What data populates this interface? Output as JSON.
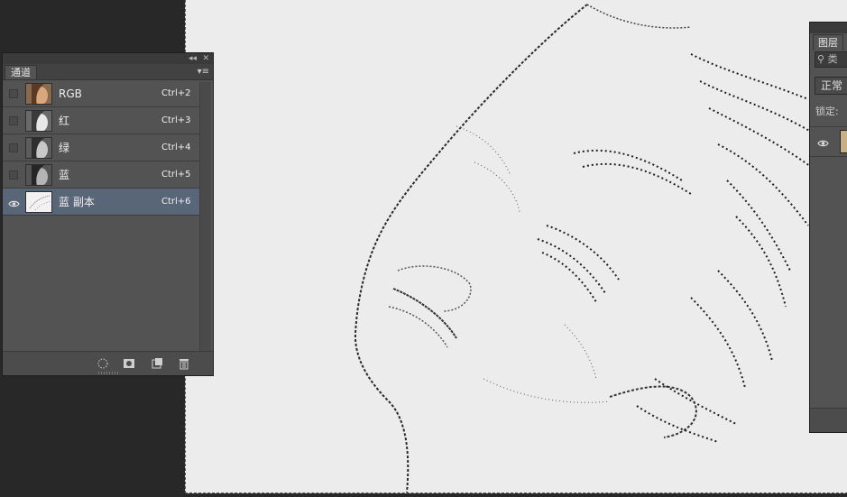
{
  "channels_panel": {
    "tab_label": "通道",
    "channels": [
      {
        "name": "RGB",
        "shortcut": "Ctrl+2",
        "visible": false,
        "selected": false
      },
      {
        "name": "红",
        "shortcut": "Ctrl+3",
        "visible": false,
        "selected": false
      },
      {
        "name": "绿",
        "shortcut": "Ctrl+4",
        "visible": false,
        "selected": false
      },
      {
        "name": "蓝",
        "shortcut": "Ctrl+5",
        "visible": false,
        "selected": false
      },
      {
        "name": "蓝 副本",
        "shortcut": "Ctrl+6",
        "visible": true,
        "selected": true
      }
    ]
  },
  "layers_panel": {
    "tab_label": "图层",
    "search_text": "类",
    "blend_mode": "正常",
    "lock_label": "锁定:"
  },
  "colors": {
    "selection_highlight": "#596678",
    "panel_bg": "#535353",
    "app_bg": "#282828"
  }
}
